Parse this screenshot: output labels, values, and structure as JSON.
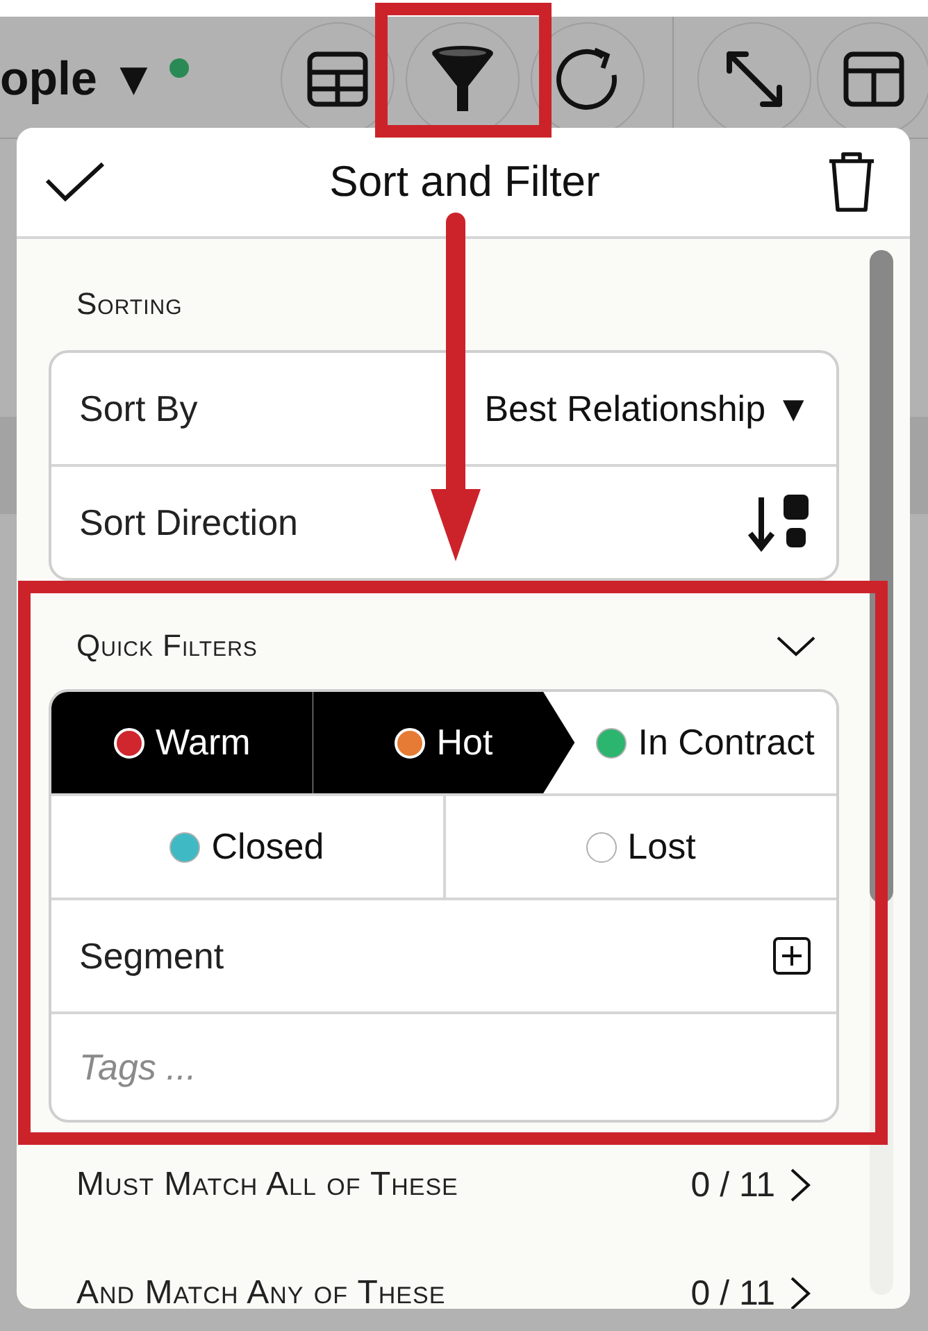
{
  "app": {
    "title": "ople ▼"
  },
  "popover": {
    "title": "Sort and Filter",
    "sorting": {
      "heading": "Sorting",
      "rows": [
        {
          "label": "Sort By",
          "value": "Best Relationship ▼",
          "kind": "select"
        },
        {
          "label": "Sort Direction",
          "kind": "direction"
        }
      ]
    },
    "quick_filters": {
      "heading": "Quick Filters",
      "expanded": true,
      "chips": [
        {
          "label": "Warm",
          "color": "#d0262d",
          "selected": true
        },
        {
          "label": "Hot",
          "color": "#e57b35",
          "selected": true
        },
        {
          "label": "In Contract",
          "color": "#2cb56e",
          "selected": false
        },
        {
          "label": "Closed",
          "color": "#3fbac4",
          "selected": false
        },
        {
          "label": "Lost",
          "color": "#ffffff",
          "selected": false
        }
      ],
      "segment": {
        "label": "Segment"
      },
      "tags": {
        "placeholder": "Tags ..."
      }
    },
    "match_rows": [
      {
        "label": "Must Match All of These",
        "count": "0 / 11"
      },
      {
        "label": "And Match Any of These",
        "count": "0 / 11"
      }
    ]
  }
}
